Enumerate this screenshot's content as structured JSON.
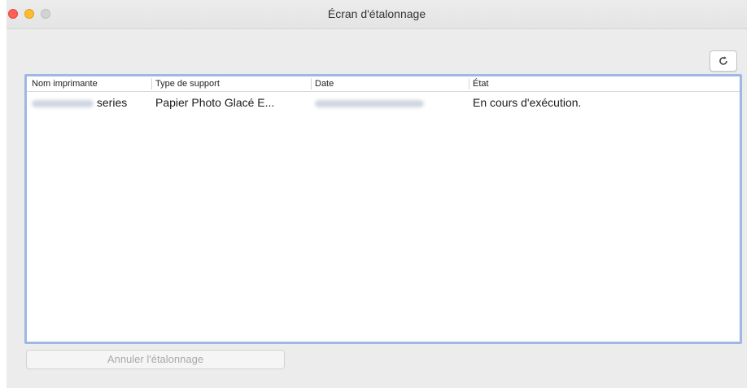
{
  "window": {
    "title": "Écran d'étalonnage"
  },
  "toolbar": {
    "refresh_icon": "refresh-icon"
  },
  "table": {
    "columns": [
      "Nom imprimante",
      "Type de support",
      "Date",
      "État"
    ],
    "rows": [
      {
        "printer_suffix": "series",
        "media_type": "Papier Photo Glacé E...",
        "status": "En cours d'exécution."
      }
    ]
  },
  "footer": {
    "cancel_label": "Annuler l'étalonnage"
  },
  "colors": {
    "close": "#ff5f57",
    "minimize": "#febc2e",
    "zoom_disabled": "#d3d3d3",
    "focus_ring": "#9fb8e3"
  }
}
